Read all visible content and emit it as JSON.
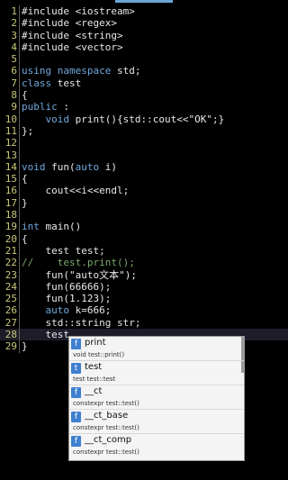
{
  "line_numbers": [
    "1",
    "2",
    "3",
    "4",
    "5",
    "6",
    "7",
    "8",
    "9",
    "10",
    "11",
    "12",
    "13",
    "14",
    "15",
    "16",
    "17",
    "18",
    "19",
    "20",
    "21",
    "22",
    "23",
    "24",
    "25",
    "26",
    "27",
    "28",
    "29"
  ],
  "code": {
    "l1": "#include <iostream>",
    "l2": "#include <regex>",
    "l3": "#include <string>",
    "l4": "#include <vector>",
    "l5": "",
    "l6_kw": "using namespace",
    "l6_rest": " std;",
    "l7_kw": "class",
    "l7_rest": " test",
    "l8": "{",
    "l9_kw": "public",
    "l9_rest": " :",
    "l10_indent": "    ",
    "l10_kw": "void",
    "l10_rest": " print(){std::cout<<\"OK\";}",
    "l11": "};",
    "l12": "",
    "l13": "",
    "l14_kw": "void",
    "l14_rest": " fun(",
    "l14_kw2": "auto",
    "l14_rest2": " i)",
    "l15": "{",
    "l16": "    cout<<i<<endl;",
    "l17": "}",
    "l18": "",
    "l19_kw": "int",
    "l19_rest": " main()",
    "l20": "{",
    "l21": "    test test;",
    "l22_comment": "//    test.print();",
    "l23": "    fun(\"auto文本\");",
    "l24": "    fun(66666);",
    "l25": "    fun(1.123);",
    "l26_indent": "    ",
    "l26_kw": "auto",
    "l26_rest": " k=666;",
    "l27": "    std::string str;",
    "l28": "    test.",
    "l29": "}"
  },
  "autocomplete": {
    "items": [
      {
        "badge": "f",
        "name": "print",
        "signature": "void test::print()"
      },
      {
        "badge": "t",
        "name": "test",
        "signature": "test test::test"
      },
      {
        "badge": "f",
        "name": "__ct",
        "signature": "constexpr test::test()"
      },
      {
        "badge": "f",
        "name": "__ct_base",
        "signature": "constexpr test::test()"
      },
      {
        "badge": "f",
        "name": "__ct_comp",
        "signature": "constexpr test::test()"
      }
    ]
  },
  "colors": {
    "background": "#000000",
    "keyword": "#6fa8dc",
    "comment": "#7aa86a",
    "line_number": "#c9c97a",
    "badge": "#3f7fd0"
  }
}
